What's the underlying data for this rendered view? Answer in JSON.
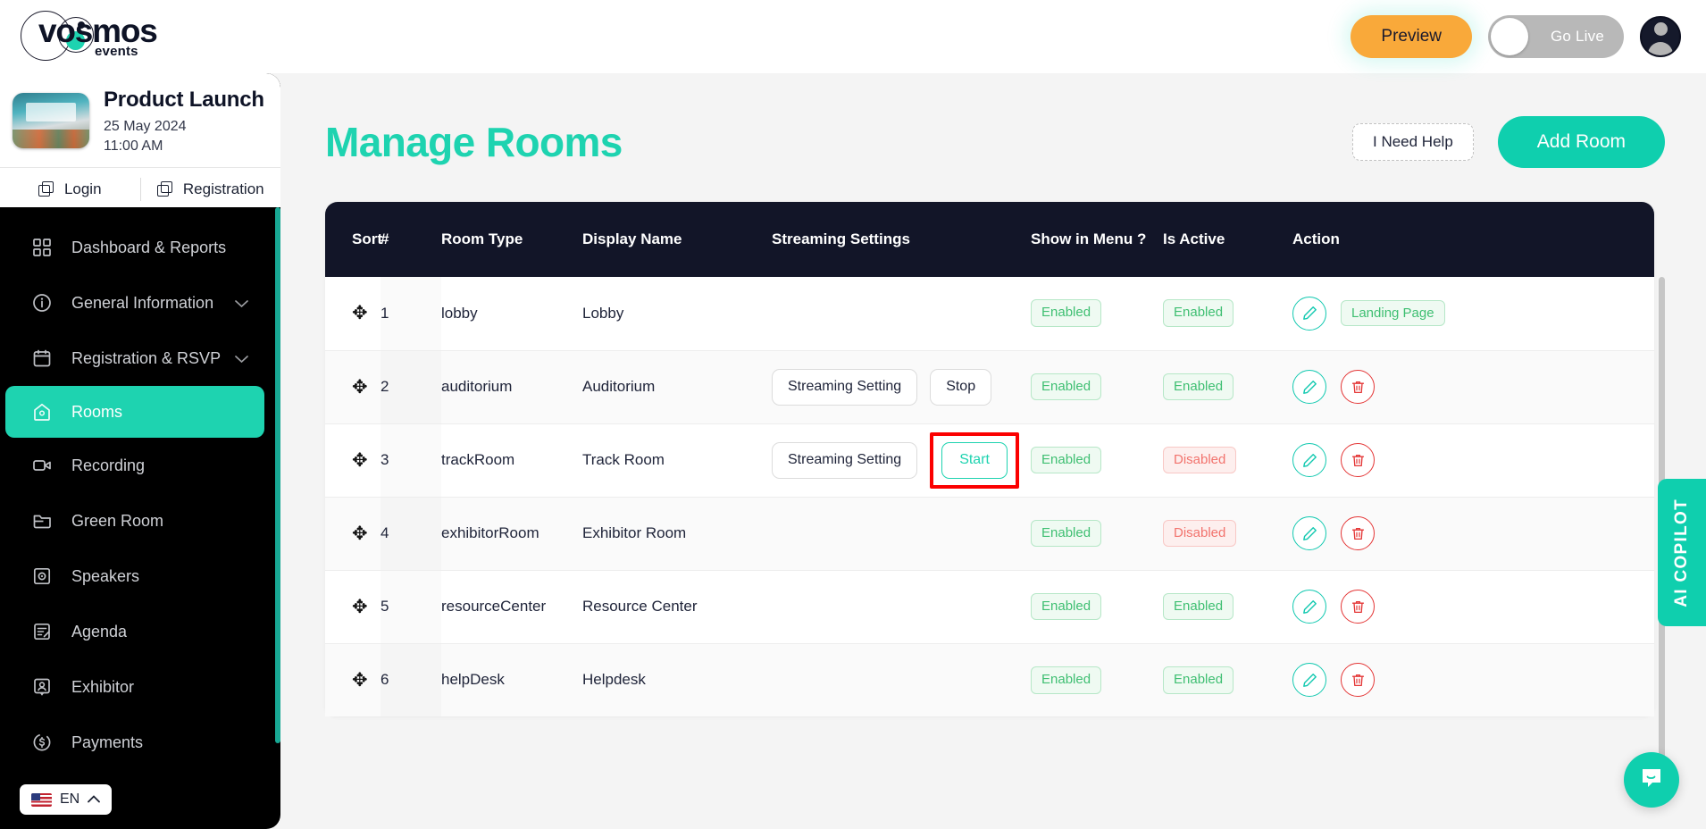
{
  "brand": {
    "name": "vosmos",
    "tagline": "events"
  },
  "topbar": {
    "preview_label": "Preview",
    "golive_label": "Go Live",
    "golive_on": false,
    "accent": "#1ed3b0",
    "preview_color": "#f9a93a"
  },
  "event": {
    "name": "Product Launch",
    "date": "25 May 2024",
    "time": "11:00 AM",
    "actions": [
      {
        "label": "Login",
        "icon": "copy-icon"
      },
      {
        "label": "Registration",
        "icon": "copy-icon"
      }
    ]
  },
  "sidebar": {
    "items": [
      {
        "label": "Dashboard & Reports",
        "icon": "grid-icon",
        "active": false,
        "chevron": false
      },
      {
        "label": "General Information",
        "icon": "info-icon",
        "active": false,
        "chevron": true
      },
      {
        "label": "Registration & RSVP",
        "icon": "calendar-icon",
        "active": false,
        "chevron": true
      },
      {
        "label": "Rooms",
        "icon": "home-icon",
        "active": true,
        "chevron": false
      },
      {
        "label": "Recording",
        "icon": "video-icon",
        "active": false,
        "chevron": false
      },
      {
        "label": "Green Room",
        "icon": "folder-icon",
        "active": false,
        "chevron": false
      },
      {
        "label": "Speakers",
        "icon": "speaker-icon",
        "active": false,
        "chevron": false
      },
      {
        "label": "Agenda",
        "icon": "agenda-icon",
        "active": false,
        "chevron": false
      },
      {
        "label": "Exhibitor",
        "icon": "exhibitor-icon",
        "active": false,
        "chevron": false
      },
      {
        "label": "Payments",
        "icon": "dollar-icon",
        "active": false,
        "chevron": false
      }
    ],
    "language": {
      "label": "EN",
      "flag": "us-flag-icon"
    }
  },
  "page": {
    "title": "Manage Rooms",
    "help_label": "I Need Help",
    "add_label": "Add Room"
  },
  "table": {
    "headers": [
      "Sort",
      "#",
      "Room Type",
      "Display Name",
      "Streaming Settings",
      "Show in Menu ?",
      "Is Active",
      "Action"
    ],
    "rows": [
      {
        "num": "1",
        "room_type": "lobby",
        "display_name": "Lobby",
        "streaming": [],
        "show_in_menu": "Enabled",
        "is_active": "Enabled",
        "actions": [
          "edit",
          "landing-page"
        ],
        "landing_label": "Landing Page",
        "highlight": false
      },
      {
        "num": "2",
        "room_type": "auditorium",
        "display_name": "Auditorium",
        "streaming": [
          {
            "label": "Streaming Setting",
            "style": "outline"
          },
          {
            "label": "Stop",
            "style": "outline"
          }
        ],
        "show_in_menu": "Enabled",
        "is_active": "Enabled",
        "actions": [
          "edit",
          "delete"
        ],
        "highlight": false
      },
      {
        "num": "3",
        "room_type": "trackRoom",
        "display_name": "Track Room",
        "streaming": [
          {
            "label": "Streaming Setting",
            "style": "outline"
          },
          {
            "label": "Start",
            "style": "start"
          }
        ],
        "show_in_menu": "Enabled",
        "is_active": "Disabled",
        "actions": [
          "edit",
          "delete"
        ],
        "highlight": true
      },
      {
        "num": "4",
        "room_type": "exhibitorRoom",
        "display_name": "Exhibitor Room",
        "streaming": [],
        "show_in_menu": "Enabled",
        "is_active": "Disabled",
        "actions": [
          "edit",
          "delete"
        ],
        "highlight": false
      },
      {
        "num": "5",
        "room_type": "resourceCenter",
        "display_name": "Resource Center",
        "streaming": [],
        "show_in_menu": "Enabled",
        "is_active": "Enabled",
        "actions": [
          "edit",
          "delete"
        ],
        "highlight": false
      },
      {
        "num": "6",
        "room_type": "helpDesk",
        "display_name": "Helpdesk",
        "streaming": [],
        "show_in_menu": "Enabled",
        "is_active": "Enabled",
        "actions": [
          "edit",
          "delete"
        ],
        "highlight": false
      }
    ]
  },
  "copilot": {
    "label": "AI COPILOT"
  },
  "chat": {
    "icon": "chat-bubble-icon"
  }
}
